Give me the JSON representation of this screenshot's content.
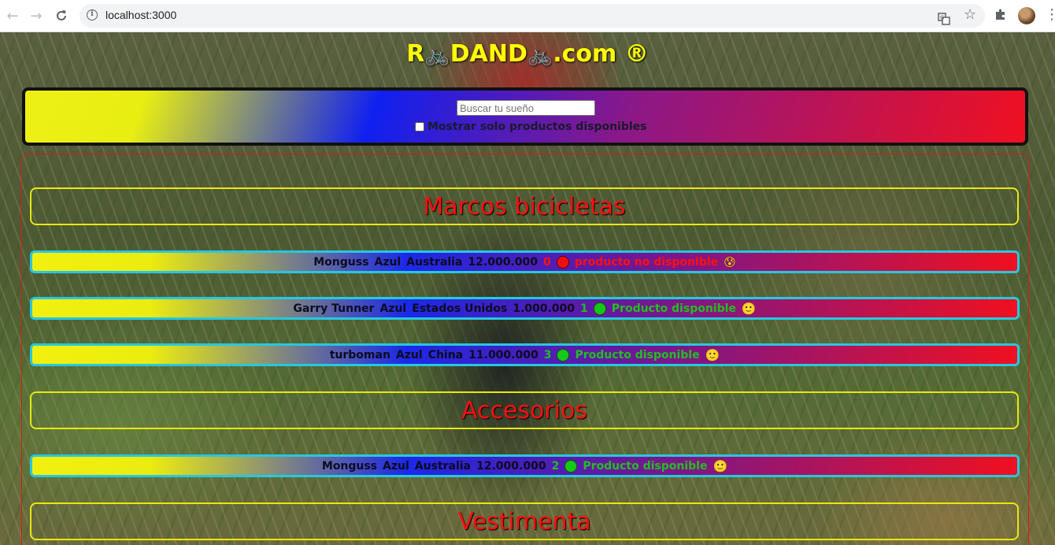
{
  "browser": {
    "url": "localhost:3000",
    "back_icon": "arrow-left-icon",
    "forward_icon": "arrow-right-icon",
    "reload_icon": "reload-icon",
    "info_icon": "info-icon",
    "translate_icon": "translate-icon",
    "bookmark_icon": "star-icon",
    "extensions_icon": "puzzle-icon",
    "menu_icon": "kebab-menu-icon"
  },
  "header": {
    "title_part1": "R",
    "bike_emoji": "🚲",
    "title_part2": "DAND",
    "title_part3": ".com ®"
  },
  "search": {
    "placeholder": "Buscar tu sueño",
    "value": "",
    "in_stock_label": "Mostrar solo productos disponibles",
    "in_stock_checked": false
  },
  "categories": [
    {
      "name": "Marcos bicicletas",
      "products": [
        {
          "name": "Monguss",
          "color": "Azul",
          "country": "Australia",
          "price": "12.000.000",
          "stock": "0",
          "available": false,
          "status": "producto no disponible",
          "emoji": "😰"
        },
        {
          "name": "Garry Tunner",
          "color": "Azul",
          "country": "Estados Unidos",
          "price": "1.000.000",
          "stock": "1",
          "available": true,
          "status": "Producto disponible",
          "emoji": "🙂"
        },
        {
          "name": "turboman",
          "color": "Azul",
          "country": "China",
          "price": "11.000.000",
          "stock": "3",
          "available": true,
          "status": "Producto disponible",
          "emoji": "🙂"
        }
      ]
    },
    {
      "name": "Accesorios",
      "products": [
        {
          "name": "Monguss",
          "color": "Azul",
          "country": "Australia",
          "price": "12.000.000",
          "stock": "2",
          "available": true,
          "status": "Producto disponible",
          "emoji": "🙂"
        }
      ]
    },
    {
      "name": "Vestimenta",
      "products": []
    }
  ],
  "colors": {
    "title_yellow": "#ffff00",
    "category_red": "#ff1010",
    "available_green": "#20c020",
    "unavailable_red": "#ff1010",
    "row_border_cyan": "#26c8e0"
  }
}
